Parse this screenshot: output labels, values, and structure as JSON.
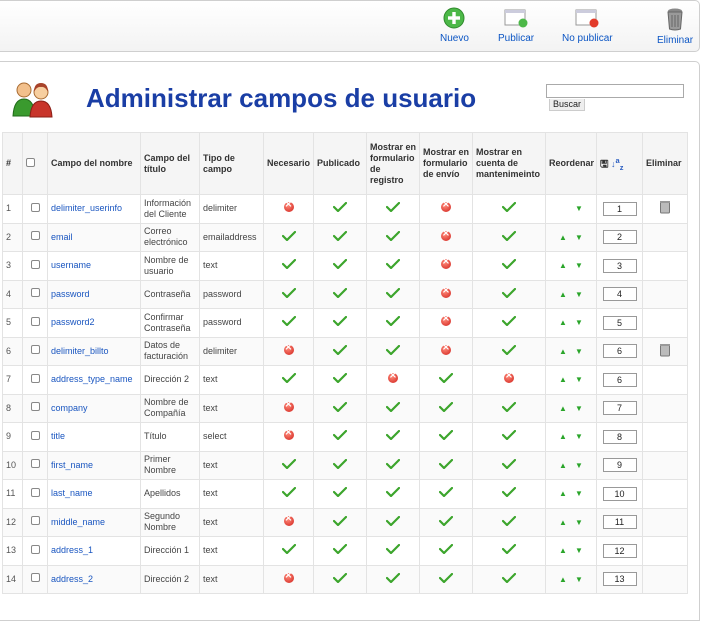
{
  "toolbar": {
    "new_label": "Nuevo",
    "publish_label": "Publicar",
    "unpublish_label": "No publicar",
    "delete_label": "Eliminar"
  },
  "title": "Administrar campos de usuario",
  "search": {
    "button_label": "Buscar",
    "value": ""
  },
  "columns": {
    "num": "#",
    "name": "Campo del nombre",
    "title": "Campo del título",
    "type": "Tipo de campo",
    "required": "Necesario",
    "published": "Publicado",
    "registration": "Mostrar en formulario de registro",
    "shipping": "Mostrar en formulario de envío",
    "account": "Mostrar en cuenta de mantenimeinto",
    "reorder": "Reordenar",
    "delete": "Eliminar"
  },
  "rows": [
    {
      "num": "1",
      "name": "delimiter_userinfo",
      "title": "Información del Cliente",
      "type": "delimiter",
      "required": false,
      "published": true,
      "registration": true,
      "shipping": false,
      "account": true,
      "up": false,
      "down": true,
      "order": "1",
      "trash": true
    },
    {
      "num": "2",
      "name": "email",
      "title": "Correo electrónico",
      "type": "emailaddress",
      "required": true,
      "published": true,
      "registration": true,
      "shipping": false,
      "account": true,
      "up": true,
      "down": true,
      "order": "2",
      "trash": false
    },
    {
      "num": "3",
      "name": "username",
      "title": "Nombre de usuario",
      "type": "text",
      "required": true,
      "published": true,
      "registration": true,
      "shipping": false,
      "account": true,
      "up": true,
      "down": true,
      "order": "3",
      "trash": false
    },
    {
      "num": "4",
      "name": "password",
      "title": "Contraseña",
      "type": "password",
      "required": true,
      "published": true,
      "registration": true,
      "shipping": false,
      "account": true,
      "up": true,
      "down": true,
      "order": "4",
      "trash": false
    },
    {
      "num": "5",
      "name": "password2",
      "title": "Confirmar Contraseña",
      "type": "password",
      "required": true,
      "published": true,
      "registration": true,
      "shipping": false,
      "account": true,
      "up": true,
      "down": true,
      "order": "5",
      "trash": false
    },
    {
      "num": "6",
      "name": "delimiter_billto",
      "title": "Datos de facturación",
      "type": "delimiter",
      "required": false,
      "published": true,
      "registration": true,
      "shipping": false,
      "account": true,
      "up": true,
      "down": true,
      "order": "6",
      "trash": true
    },
    {
      "num": "7",
      "name": "address_type_name",
      "title": "Dirección 2",
      "type": "text",
      "required": true,
      "published": true,
      "registration": false,
      "shipping": true,
      "account": false,
      "up": true,
      "down": true,
      "order": "6",
      "trash": false
    },
    {
      "num": "8",
      "name": "company",
      "title": "Nombre de Compañía",
      "type": "text",
      "required": false,
      "published": true,
      "registration": true,
      "shipping": true,
      "account": true,
      "up": true,
      "down": true,
      "order": "7",
      "trash": false
    },
    {
      "num": "9",
      "name": "title",
      "title": "Título",
      "type": "select",
      "required": false,
      "published": true,
      "registration": true,
      "shipping": true,
      "account": true,
      "up": true,
      "down": true,
      "order": "8",
      "trash": false
    },
    {
      "num": "10",
      "name": "first_name",
      "title": "Primer Nombre",
      "type": "text",
      "required": true,
      "published": true,
      "registration": true,
      "shipping": true,
      "account": true,
      "up": true,
      "down": true,
      "order": "9",
      "trash": false
    },
    {
      "num": "11",
      "name": "last_name",
      "title": "Apellidos",
      "type": "text",
      "required": true,
      "published": true,
      "registration": true,
      "shipping": true,
      "account": true,
      "up": true,
      "down": true,
      "order": "10",
      "trash": false
    },
    {
      "num": "12",
      "name": "middle_name",
      "title": "Segundo Nombre",
      "type": "text",
      "required": false,
      "published": true,
      "registration": true,
      "shipping": true,
      "account": true,
      "up": true,
      "down": true,
      "order": "11",
      "trash": false
    },
    {
      "num": "13",
      "name": "address_1",
      "title": "Dirección 1",
      "type": "text",
      "required": true,
      "published": true,
      "registration": true,
      "shipping": true,
      "account": true,
      "up": true,
      "down": true,
      "order": "12",
      "trash": false
    },
    {
      "num": "14",
      "name": "address_2",
      "title": "Dirección 2",
      "type": "text",
      "required": false,
      "published": true,
      "registration": true,
      "shipping": true,
      "account": true,
      "up": true,
      "down": true,
      "order": "13",
      "trash": false
    }
  ]
}
